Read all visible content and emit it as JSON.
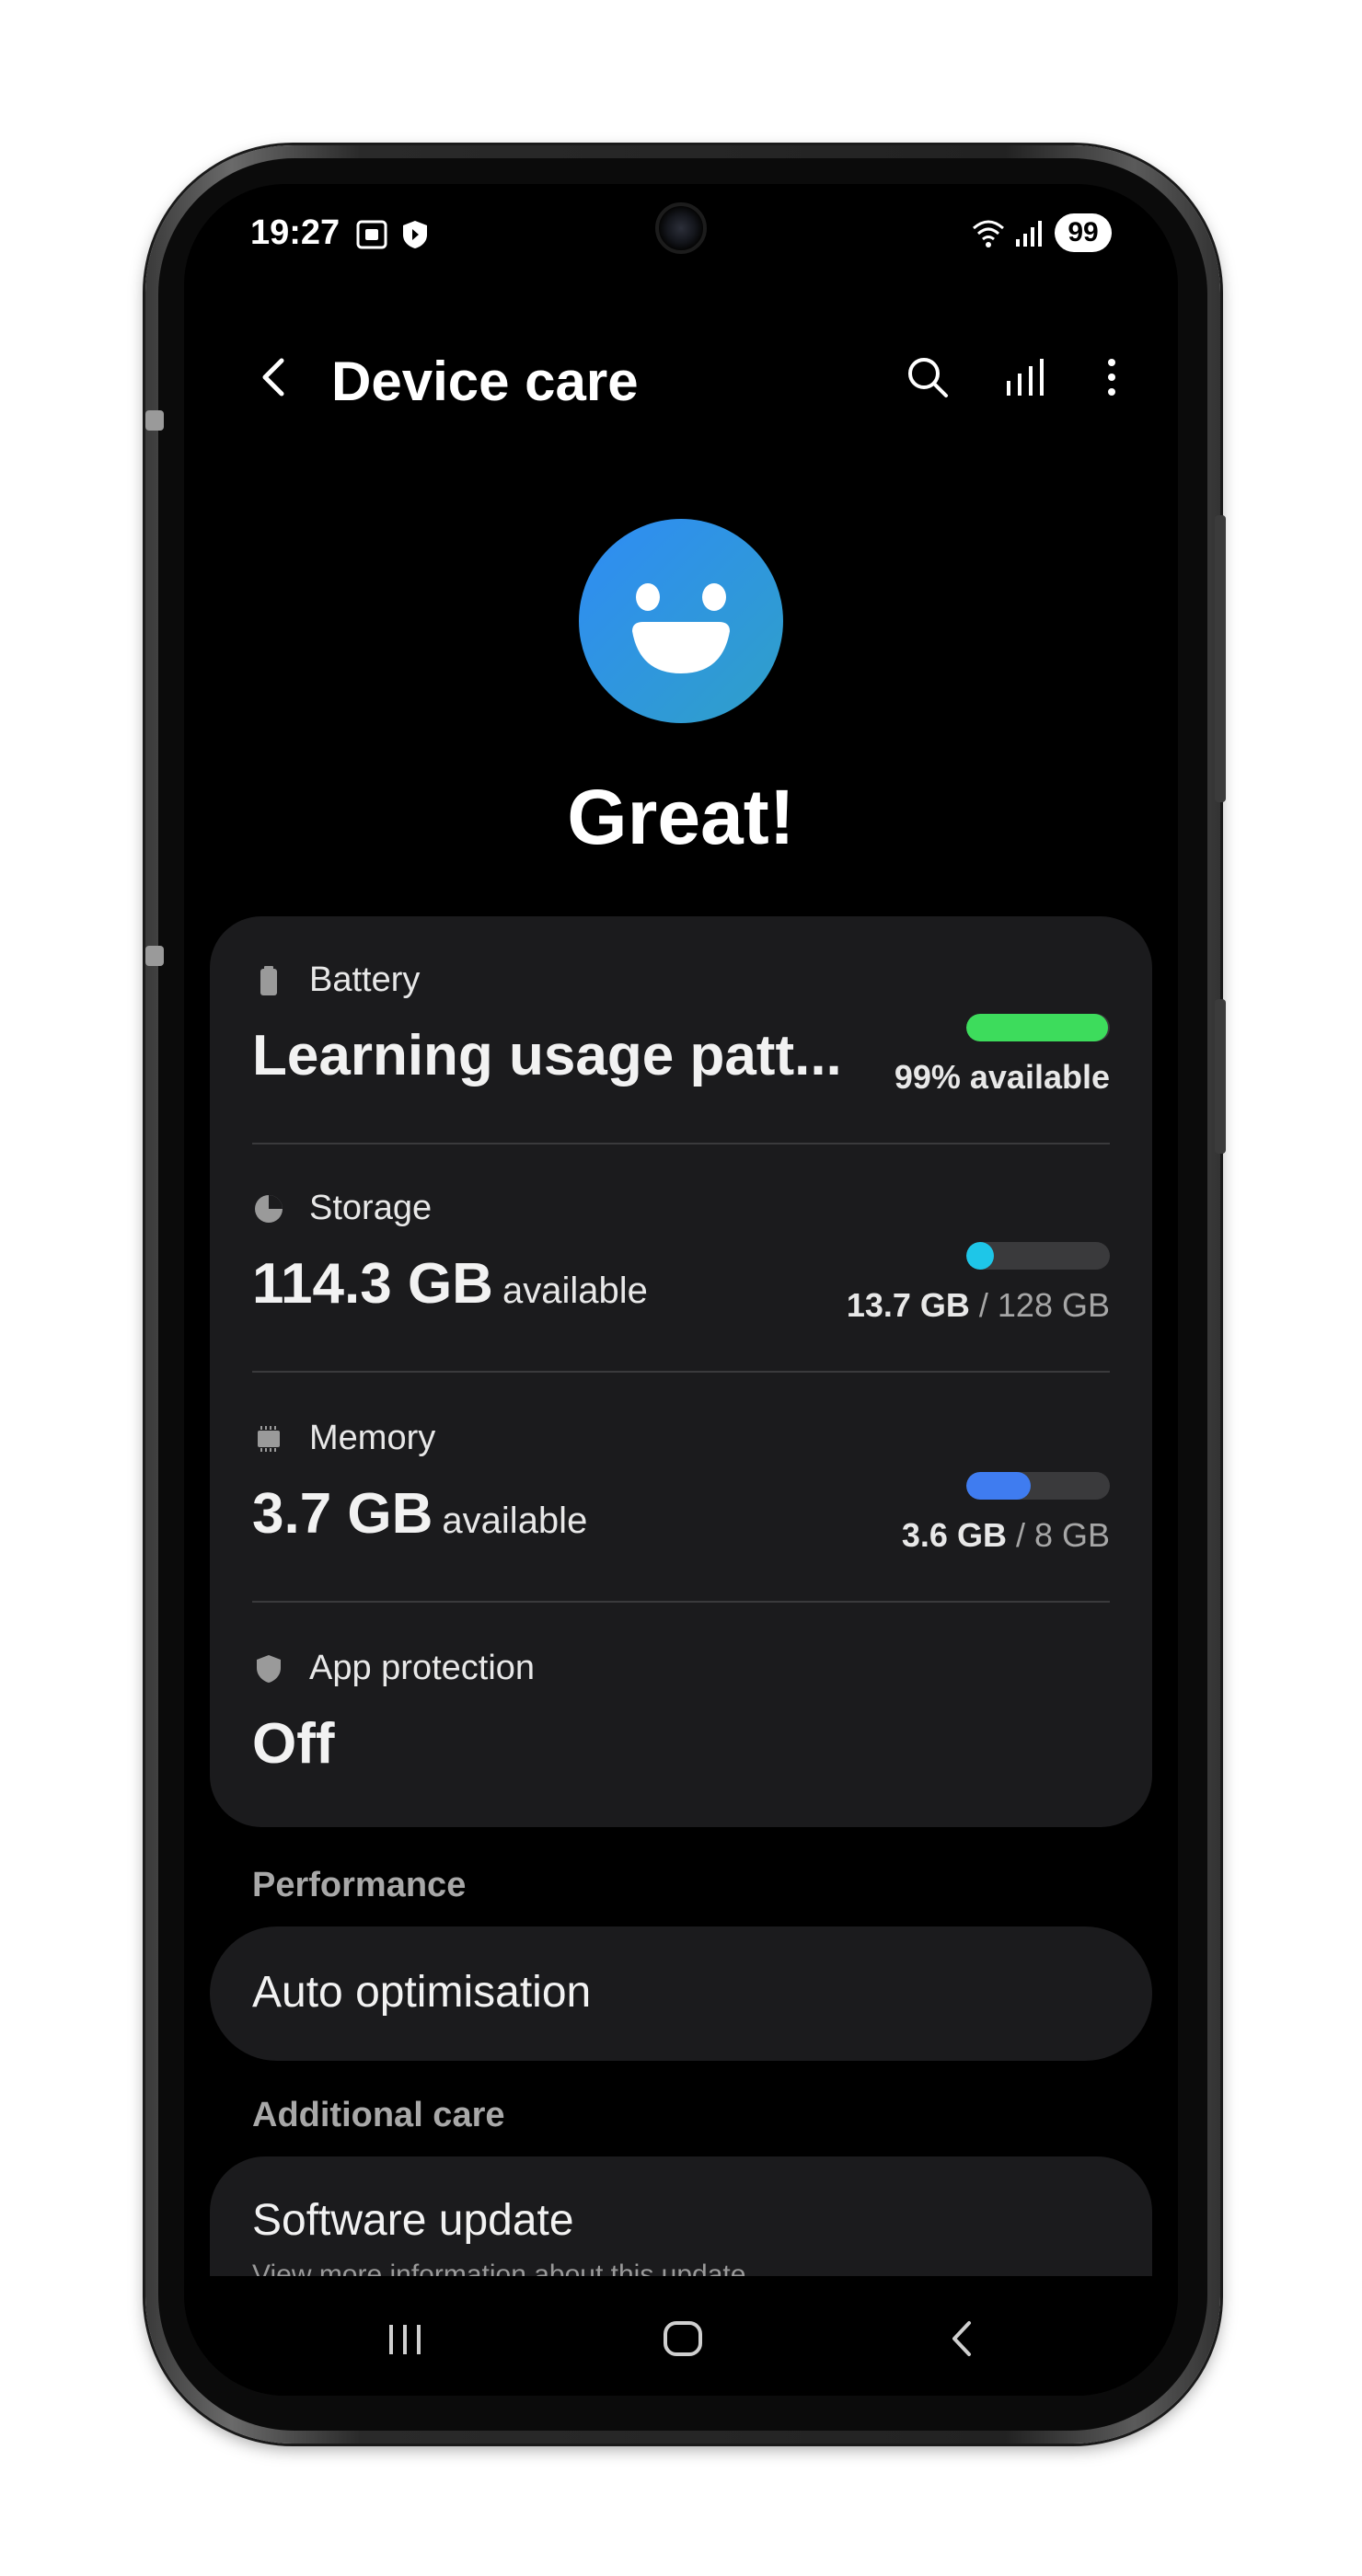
{
  "status_bar": {
    "time": "19:27",
    "battery_level": "99",
    "left_icons": [
      "screenshot-icon",
      "shield-icon"
    ],
    "right_icons": [
      "wifi-icon",
      "signal-icon"
    ]
  },
  "appbar": {
    "title": "Device care",
    "actions": [
      "search-icon",
      "stats-icon",
      "more-icon"
    ]
  },
  "hero": {
    "status_word": "Great!",
    "icon": "smiley-icon"
  },
  "card": {
    "battery": {
      "label": "Battery",
      "value": "Learning usage patt...",
      "right": "99% available",
      "level": 0.99,
      "color": "#3ddc5c"
    },
    "storage": {
      "label": "Storage",
      "value": "114.3 GB",
      "unit": "available",
      "used": "13.7 GB",
      "sep": "/ 128 GB",
      "level": 0.107,
      "color": "#1ec6e8"
    },
    "memory": {
      "label": "Memory",
      "value": "3.7 GB",
      "unit": "available",
      "used": "3.6 GB",
      "sep": "/ 8 GB",
      "level": 0.45,
      "color": "#3f7cf0"
    },
    "app_protection": {
      "label": "App protection",
      "value": "Off"
    }
  },
  "sections": {
    "performance": {
      "title": "Performance",
      "item": "Auto optimisation"
    },
    "additional": {
      "title": "Additional care",
      "item": "Software update",
      "sub": "View more information about this update"
    }
  },
  "navbar": [
    "recents-icon",
    "home-icon",
    "back-icon"
  ]
}
